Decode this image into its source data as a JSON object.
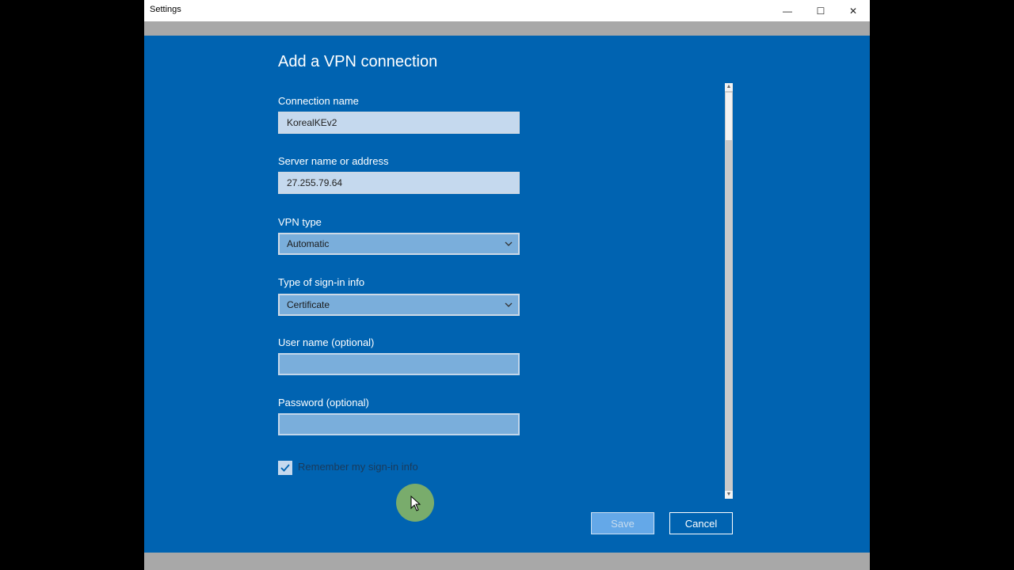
{
  "window": {
    "title": "Settings",
    "controls": {
      "minimize": "—",
      "maximize": "☐",
      "close": "✕"
    }
  },
  "dialog": {
    "heading": "Add a VPN connection",
    "fields": {
      "connection_name": {
        "label": "Connection name",
        "value": "KorealKEv2"
      },
      "server": {
        "label": "Server name or address",
        "value": "27.255.79.64"
      },
      "vpn_type": {
        "label": "VPN type",
        "value": "Automatic"
      },
      "signin_type": {
        "label": "Type of sign-in info",
        "value": "Certificate"
      },
      "username": {
        "label": "User name (optional)",
        "value": ""
      },
      "password": {
        "label": "Password (optional)",
        "value": ""
      }
    },
    "remember": {
      "label": "Remember my sign-in info",
      "checked": true
    },
    "buttons": {
      "save": "Save",
      "cancel": "Cancel"
    }
  },
  "icons": {
    "chevron": "chevron-down-icon",
    "check": "checkmark-icon",
    "cursor": "mouse-pointer-icon"
  },
  "colors": {
    "dialog_bg": "#0063b1",
    "field_filled_bg": "#c5d9ee",
    "field_empty_bg": "#7aaedb",
    "save_disabled_bg": "#64a8e8",
    "cursor_highlight": "#7fb068"
  }
}
